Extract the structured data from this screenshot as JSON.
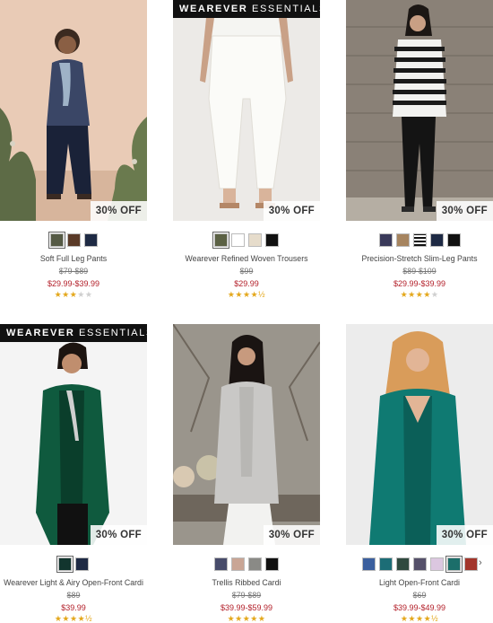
{
  "colors": {
    "sale": "#b3202a",
    "star": "#e4a81d",
    "star_empty": "#cfcfcf"
  },
  "products": [
    {
      "name": "Soft Full Leg Pants",
      "price_original": "$79-$89",
      "price_sale": "$29.99-$39.99",
      "discount": "30% OFF",
      "rating": 3,
      "swatches": [
        "#555a45",
        "#5a3a28",
        "#1e2a44"
      ],
      "essentials": false
    },
    {
      "name": "Wearever Refined Woven Trousers",
      "price_original": "$99",
      "price_sale": "$29.99",
      "discount": "30% OFF",
      "rating": 4.5,
      "swatches": [
        "#5b6144",
        "#ffffff",
        "#e6dccb",
        "#111111"
      ],
      "essentials": true
    },
    {
      "name": "Precision-Stretch Slim-Leg Pants",
      "price_original": "$89-$109",
      "price_sale": "$29.99-$39.99",
      "discount": "30% OFF",
      "rating": 4,
      "swatches": [
        "#3a3a5a",
        "#a6845f",
        "stripe",
        "#1e2a44",
        "#111111"
      ],
      "essentials": false
    },
    {
      "name": "Wearever Light & Airy Open-Front Cardi",
      "price_original": "$89",
      "price_sale": "$39.99",
      "discount": "30% OFF",
      "rating": 4.5,
      "swatches": [
        "#12352e",
        "#1e2a44"
      ],
      "essentials": true
    },
    {
      "name": "Trellis Ribbed Cardi",
      "price_original": "$79-$89",
      "price_sale": "$39.99-$59.99",
      "discount": "30% OFF",
      "rating": 5,
      "swatches": [
        "#474b6a",
        "#c9a595",
        "#8a8a86",
        "#111111"
      ],
      "essentials": false
    },
    {
      "name": "Light Open-Front Cardi",
      "price_original": "$69",
      "price_sale": "$39.99-$49.99",
      "discount": "30% OFF",
      "rating": 4.5,
      "swatches": [
        "#3b5f9e",
        "#1c6d76",
        "#2f4a3f",
        "#55506a",
        "#dcc7e0",
        "#1c6e6a",
        "#a3352b"
      ],
      "essentials": false
    }
  ],
  "essentials_tag": {
    "bold": "WEAREVER",
    "light": "ESSENTIALS"
  },
  "nav": {
    "next_glyph": "›"
  }
}
